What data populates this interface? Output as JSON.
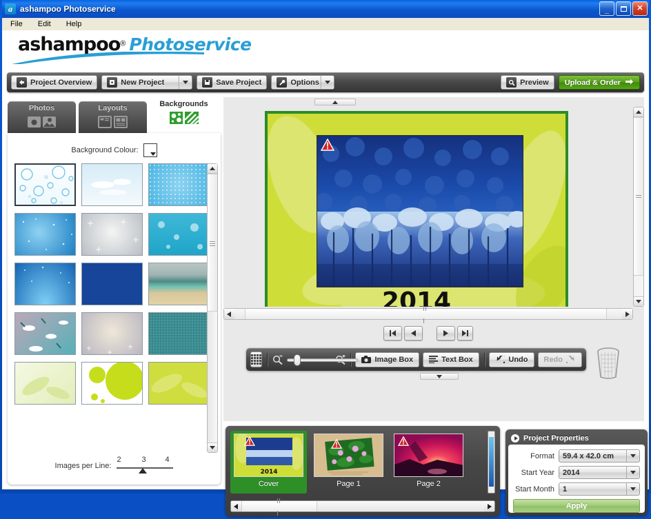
{
  "window": {
    "title": "ashampoo Photoservice",
    "app_icon": "a",
    "minimize": "_",
    "maximize": "□",
    "close": "✕"
  },
  "menubar": {
    "items": [
      "File",
      "Edit",
      "Help"
    ]
  },
  "brand": {
    "name": "ashampoo",
    "registered": "®",
    "product": "Photoservice",
    "accent_color": "#2a9fd4"
  },
  "toolbar": {
    "project_overview": "Project Overview",
    "new_project": "New Project",
    "save_project": "Save Project",
    "options": "Options",
    "preview": "Preview",
    "upload_order": "Upload & Order",
    "upload_color": "#56a017"
  },
  "sidebar": {
    "tabs": [
      {
        "label": "Photos",
        "active": false
      },
      {
        "label": "Layouts",
        "active": false
      },
      {
        "label": "Backgrounds",
        "active": true
      }
    ],
    "background_colour_label": "Background Colour:",
    "background_colour_value": "#ffffff",
    "images_per_line_label": "Images per Line:",
    "images_per_line_options": [
      "2",
      "3",
      "4"
    ],
    "images_per_line_value": "3",
    "thumbnails": [
      {
        "name": "bubbles-light",
        "selected": true
      },
      {
        "name": "sky-clouds",
        "selected": false
      },
      {
        "name": "blue-dots",
        "selected": false
      },
      {
        "name": "blue-stars",
        "selected": false
      },
      {
        "name": "grey-snowflakes",
        "selected": false
      },
      {
        "name": "teal-bubbles",
        "selected": false
      },
      {
        "name": "blue-rays",
        "selected": false
      },
      {
        "name": "navy-solid",
        "selected": false
      },
      {
        "name": "beach-vintage",
        "selected": false
      },
      {
        "name": "clouds-retro",
        "selected": false
      },
      {
        "name": "snow-grey",
        "selected": false
      },
      {
        "name": "teal-texture",
        "selected": false
      },
      {
        "name": "green-leaf-pale",
        "selected": false
      },
      {
        "name": "lime-circles",
        "selected": false
      },
      {
        "name": "lime-leaf",
        "selected": false
      }
    ]
  },
  "canvas": {
    "page_background_color": "#cfdd39",
    "page_border_color": "#2d8c27",
    "year_text": "2014",
    "photo_name": "winter-forest-blue",
    "warning_badge": "!"
  },
  "page_nav": {
    "first": "first-page",
    "prev": "previous-page",
    "next": "next-page",
    "last": "last-page"
  },
  "edit_toolbar": {
    "grid": "grid-toggle",
    "zoom_out": "zoom-out",
    "zoom_in": "zoom-in",
    "zoom_value": 12,
    "image_box": "Image Box",
    "text_box": "Text Box",
    "undo": "Undo",
    "redo": "Redo",
    "redo_disabled": true,
    "trash": "trash-can"
  },
  "page_strip": {
    "pages": [
      {
        "label": "Cover",
        "selected": true,
        "thumb": "winter-forest-cover",
        "year": "2014"
      },
      {
        "label": "Page 1",
        "selected": false,
        "thumb": "lotus-flowers"
      },
      {
        "label": "Page 2",
        "selected": false,
        "thumb": "red-sunset"
      }
    ]
  },
  "project_properties": {
    "title": "Project Properties",
    "fields": [
      {
        "label": "Format",
        "value": "59.4 x 42.0 cm"
      },
      {
        "label": "Start Year",
        "value": "2014"
      },
      {
        "label": "Start Month",
        "value": "1"
      }
    ],
    "apply_label": "Apply",
    "apply_color": "#9dc977"
  }
}
